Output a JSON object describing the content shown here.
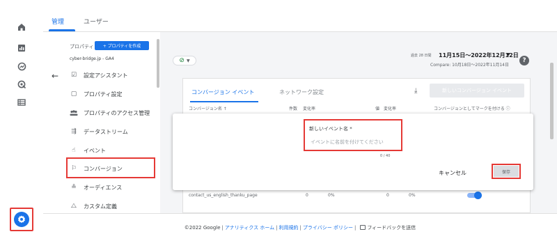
{
  "tabs": [
    {
      "label": "管理",
      "active": true
    },
    {
      "label": "ユーザー",
      "active": false
    }
  ],
  "property": {
    "label": "プロパティ",
    "create_button": "+ プロパティを作成",
    "name": "cyber-bridge.jp - GA4"
  },
  "nav": [
    {
      "label": "設定アシスタント",
      "icon": "checkbox-icon"
    },
    {
      "label": "プロパティ設定",
      "icon": "settings-square-icon"
    },
    {
      "label": "プロパティのアクセス管理",
      "icon": "group-icon"
    },
    {
      "label": "データストリーム",
      "icon": "streams-icon"
    },
    {
      "label": "イベント",
      "icon": "touch-icon"
    },
    {
      "label": "コンバージョン",
      "icon": "flag-icon"
    },
    {
      "label": "オーディエンス",
      "icon": "audience-icon"
    },
    {
      "label": "カスタム定義",
      "icon": "shapes-icon"
    }
  ],
  "date": {
    "period": "過去 28 日間",
    "range": "11月15日～2022年12月12日",
    "compare": "Compare: 10月18日～2022年11月14日"
  },
  "card": {
    "tabs": [
      "コンバージョン イベント",
      "ネットワーク設定"
    ],
    "new_button": "新しいコンバージョン イベント",
    "headers": [
      "コンバージョン名 ↑",
      "件数",
      "変化率",
      "値",
      "変化率",
      "コンバージョンとしてマークを付ける ⓘ"
    ],
    "row": [
      "contact_us_english_thanku_page",
      "0",
      "0%",
      "0",
      "0%"
    ]
  },
  "dialog": {
    "field_label": "新しいイベント名 *",
    "placeholder": "イベントに名前を付けてください",
    "counter": "0 / 40",
    "cancel": "キャンセル",
    "save": "保存"
  },
  "footer": {
    "copyright": "©2022 Google",
    "links": [
      "アナリティクス ホーム",
      "利用規約",
      "プライバシー ポリシー"
    ],
    "feedback": "フィードバックを送信"
  },
  "colors": {
    "accent": "#1a73e8",
    "highlight": "#e53935"
  }
}
